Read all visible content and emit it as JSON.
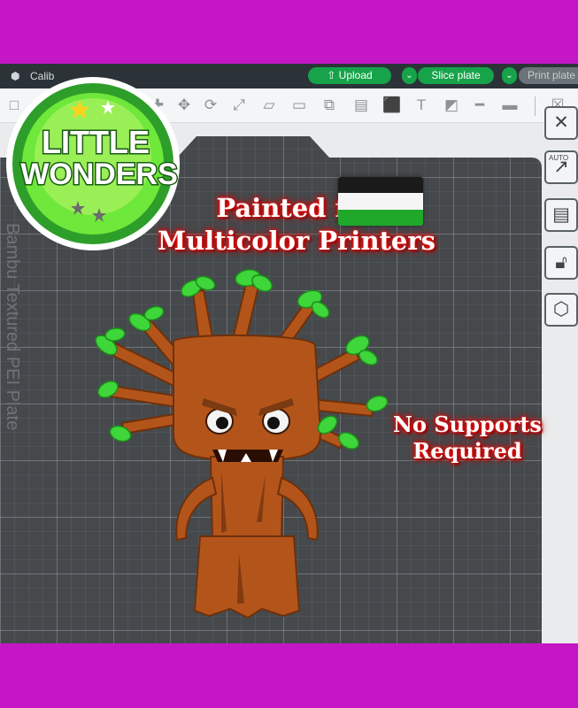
{
  "titlebar": {
    "project_name": "Calib",
    "upload_label": "Upload",
    "slice_label": "Slice plate",
    "print_label": "Print plate"
  },
  "toolbar": {
    "icons": [
      "add-icon",
      "grid-icon",
      "cube-icon",
      "arrange-icon",
      "orient-icon",
      "move-icon",
      "rotate-icon",
      "scale-icon",
      "lay-flat-icon",
      "cut-icon",
      "support-icon",
      "seam-icon",
      "assembly-icon",
      "text-icon",
      "paint-icon",
      "measure-icon",
      "emboss-icon",
      "split-icon"
    ]
  },
  "sidebar": {
    "icons": [
      "close-icon",
      "auto-orient-icon",
      "layout-icon",
      "lock-icon",
      "settings-hex-icon"
    ],
    "auto_label": "AUTO"
  },
  "logo": {
    "line1": "LITTLE",
    "line2": "WONDERS"
  },
  "headline": {
    "line1": "Painted for",
    "line2": "Multicolor Printers"
  },
  "subline": {
    "line1": "No Supports",
    "line2": "Required"
  },
  "plate_label": "Bambu Textured PEI Plate",
  "colors": {
    "frame": "#c416c4",
    "accent_green": "#16a34a",
    "trunk_brown": "#b3551b",
    "leaf_green": "#3ed63a",
    "swatch": [
      "#1a1a1a",
      "#f5f5f5",
      "#1fa82a",
      "#7a3a12"
    ]
  }
}
